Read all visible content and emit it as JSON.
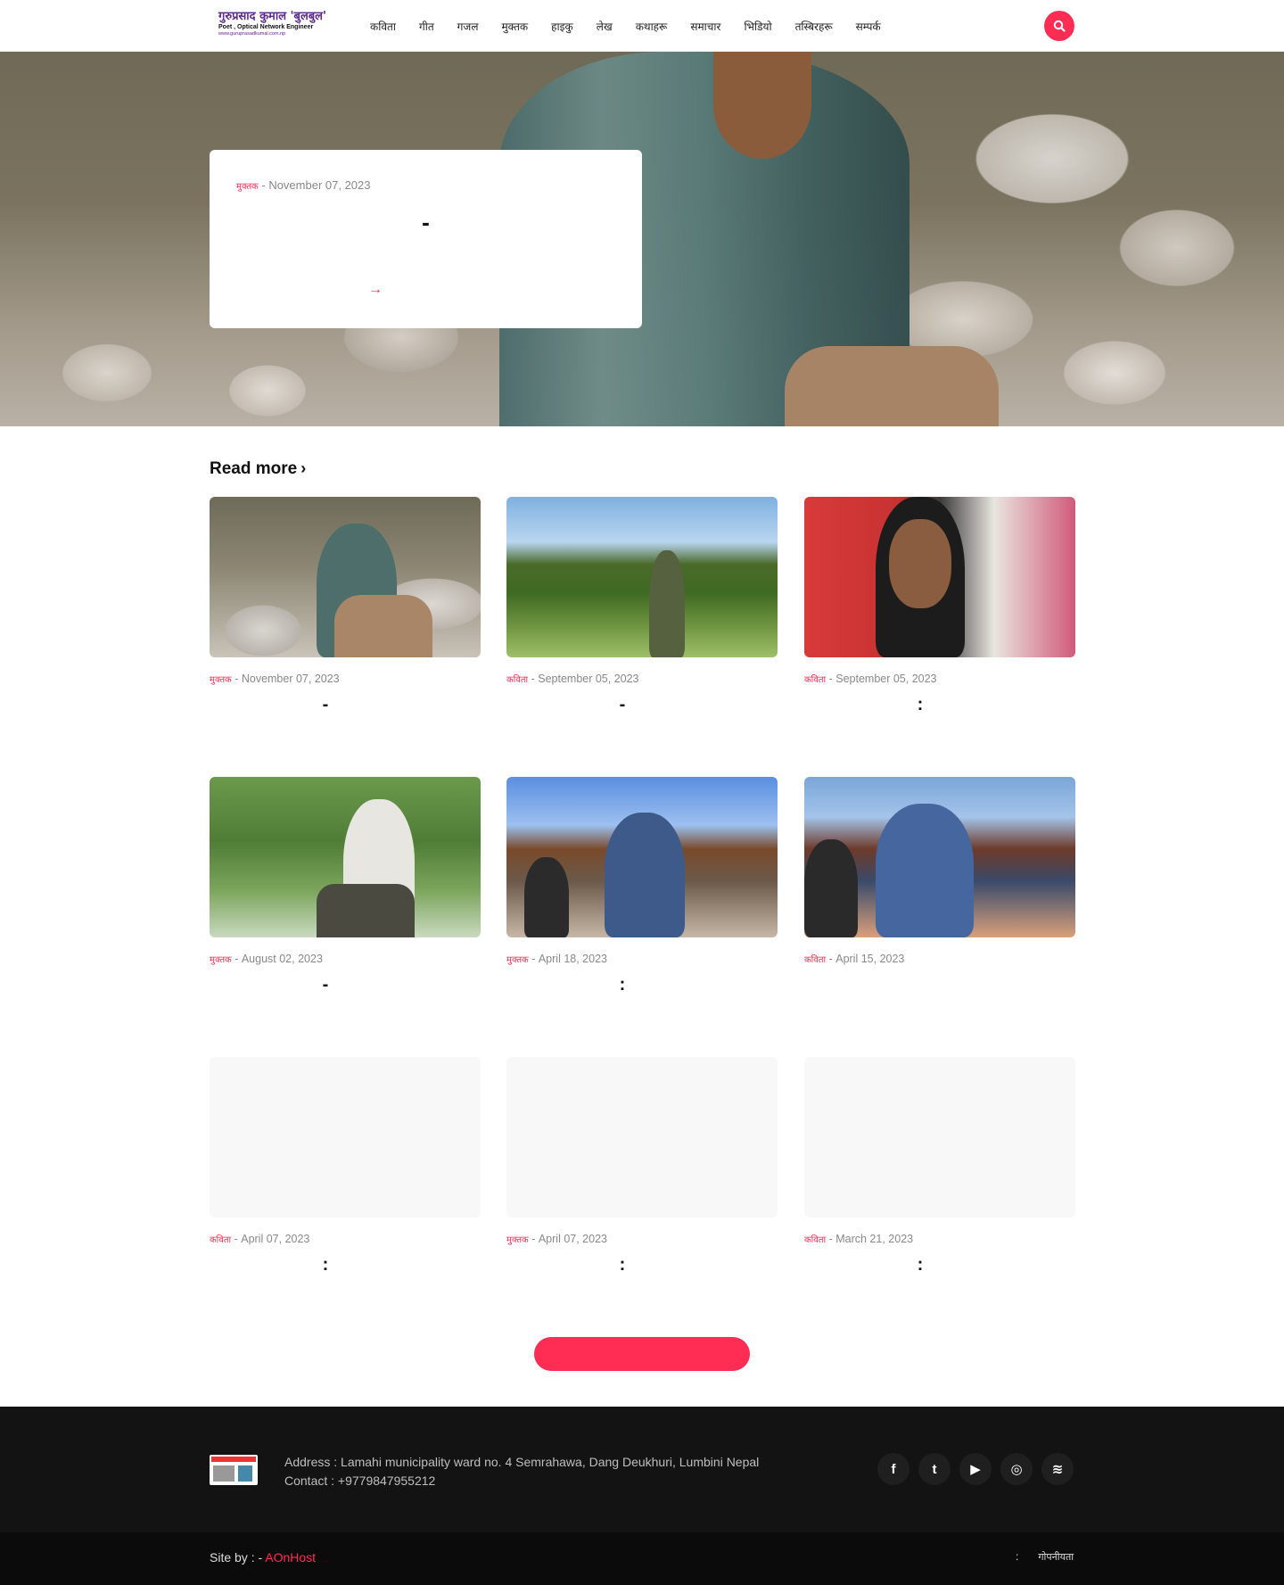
{
  "header": {
    "logo": {
      "line1": "गुरुप्रसाद कुमाल 'बुलबुल'",
      "line2": "Poet , Optical Network Engineer",
      "line3": "www.guruprasadkumal.com.np"
    },
    "nav": [
      "कविता",
      "गीत",
      "गजल",
      "मुक्तक",
      "हाइकु",
      "लेख",
      "कथाहरू",
      "समाचार",
      "भिडियो",
      "तस्बिरहरू",
      "सम्पर्क"
    ],
    "search_icon": "search-icon"
  },
  "hero": {
    "category": "मुक्तक",
    "date": "November 07, 2023",
    "title": "-",
    "arrow": "→"
  },
  "section": {
    "title": "Read more",
    "chevron": "›"
  },
  "posts": [
    {
      "category": "मुक्तक",
      "date": "November 07, 2023",
      "title": "-"
    },
    {
      "category": "कविता",
      "date": "September 05, 2023",
      "title": "-"
    },
    {
      "category": "कविता",
      "date": "September 05, 2023",
      "title": ":"
    },
    {
      "category": "मुक्तक",
      "date": "August 02, 2023",
      "title": "-"
    },
    {
      "category": "मुक्तक",
      "date": "April 18, 2023",
      "title": ":"
    },
    {
      "category": "कविता",
      "date": "April 15, 2023",
      "title": ""
    },
    {
      "category": "कविता",
      "date": "April 07, 2023",
      "title": ":"
    },
    {
      "category": "मुक्तक",
      "date": "April 07, 2023",
      "title": ":"
    },
    {
      "category": "कविता",
      "date": "March 21, 2023",
      "title": ":"
    }
  ],
  "more_button": {
    "label": ""
  },
  "footer": {
    "address": "Address : Lamahi municipality ward no. 4 Semrahawa, Dang Deukhuri, Lumbini Nepal Contact : +9779847955212",
    "social": [
      {
        "icon": "facebook-icon",
        "glyph": "f"
      },
      {
        "icon": "twitter-icon",
        "glyph": "t"
      },
      {
        "icon": "youtube-icon",
        "glyph": "▶"
      },
      {
        "icon": "instagram-icon",
        "glyph": "◎"
      },
      {
        "icon": "rss-icon",
        "glyph": "≋"
      }
    ],
    "credit_prefix": "Site by : - ",
    "credit_brand": "AOnHost",
    "right_colon": ":",
    "right_text": "गोपनीयता"
  },
  "colors": {
    "accent": "#ff2c54",
    "footer_bg": "#131313",
    "bottom_bg": "#0b0b0b"
  }
}
